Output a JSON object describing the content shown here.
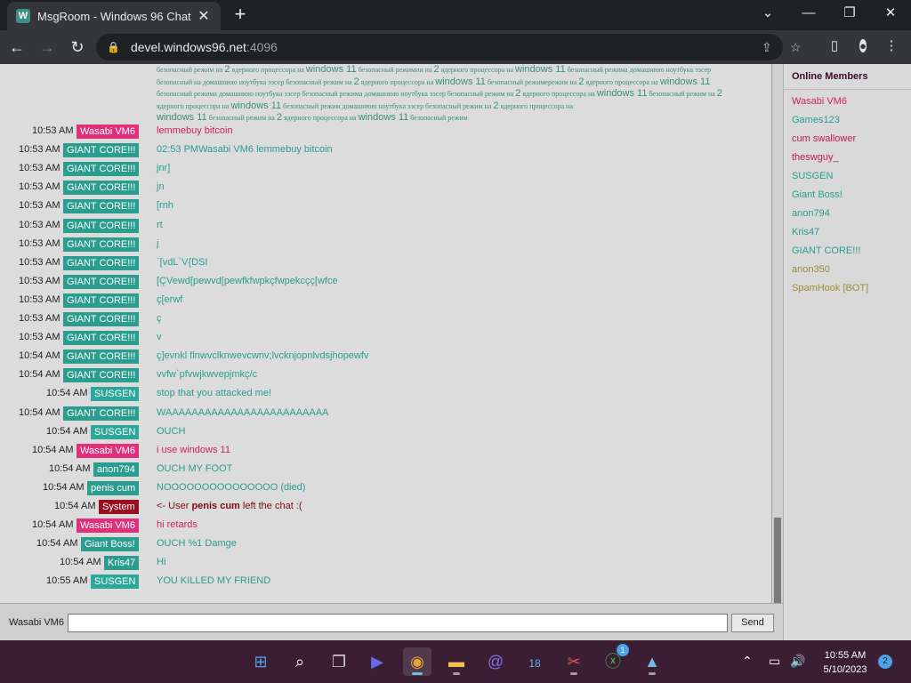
{
  "browser": {
    "tab_title": "MsgRoom - Windows 96 Chat",
    "tab_icon": "W",
    "new_tab": "+",
    "url_host": "devel.windows96.net",
    "url_port": ":4096",
    "window_controls": {
      "chevron": "⌄",
      "minimize": "—",
      "restore": "❐",
      "close": "✕"
    },
    "nav": {
      "back": "←",
      "forward": "→",
      "reload": "↻"
    },
    "lock": "🔒",
    "share": "⇪",
    "star": "☆",
    "sidepanel": "▯",
    "profile": "●",
    "menu": "⋮"
  },
  "chat": {
    "spam_lines": [
      [
        "безопасный режим на ",
        "2",
        " ядерного процессора на ",
        "windows 11",
        " безопасный режимии на ",
        "2",
        " ядерного процессора на ",
        "windows 11",
        " безопасный режима домашнюю ноутбука ээсер"
      ],
      [
        "безопасный на домашнюю ноутбука ээсер безопасный режим на ",
        "2",
        " ядерного процессора на ",
        "windows 11",
        " безопасный режимережим на ",
        "2",
        " ядерного процессора на ",
        "windows 11",
        ""
      ],
      [
        "безопасный режима домашнюю ноутбука ээсер безопасный режима домашнюю ноутбука ээсер безопасный режим на ",
        "2",
        " ядерного процессора на ",
        "windows 11",
        " безопасный режим на ",
        "2",
        ""
      ],
      [
        "ядерного процессора на ",
        "windows 11",
        " безопасный режим домашнюю ноутбука ээсер безопасный режим на ",
        "2",
        " ядерного процессора на ",
        "",
        ""
      ],
      [
        "",
        "windows 11",
        " безопасный режим на ",
        "2",
        " ядерного процессора на ",
        "windows 11",
        " безопасный режим"
      ]
    ],
    "messages": [
      {
        "time": "10:53 AM",
        "user": "Wasabi VM6",
        "color": "#e0307a",
        "text": "lemmebuy bitcoin",
        "text_color": "#d02060"
      },
      {
        "time": "10:53 AM",
        "user": "GIANT CORE!!!",
        "color": "#2a9d8f",
        "text": "02:53 PMWasabi VM6 lemmebuy bitcoin",
        "text_color": "#2a9d8f"
      },
      {
        "time": "10:53 AM",
        "user": "GIANT CORE!!!",
        "color": "#2a9d8f",
        "text": "jnr]",
        "text_color": "#2a9d8f"
      },
      {
        "time": "10:53 AM",
        "user": "GIANT CORE!!!",
        "color": "#2a9d8f",
        "text": "jn",
        "text_color": "#2a9d8f"
      },
      {
        "time": "10:53 AM",
        "user": "GIANT CORE!!!",
        "color": "#2a9d8f",
        "text": "[rnh",
        "text_color": "#2a9d8f"
      },
      {
        "time": "10:53 AM",
        "user": "GIANT CORE!!!",
        "color": "#2a9d8f",
        "text": "rt",
        "text_color": "#2a9d8f"
      },
      {
        "time": "10:53 AM",
        "user": "GIANT CORE!!!",
        "color": "#2a9d8f",
        "text": "j",
        "text_color": "#2a9d8f"
      },
      {
        "time": "10:53 AM",
        "user": "GIANT CORE!!!",
        "color": "#2a9d8f",
        "text": "`[vdL`V{DSI",
        "text_color": "#2a9d8f"
      },
      {
        "time": "10:53 AM",
        "user": "GIANT CORE!!!",
        "color": "#2a9d8f",
        "text": "[ÇVewd[pewvd[pewfkfwpkçfwpekcçç[wfce",
        "text_color": "#2a9d8f"
      },
      {
        "time": "10:53 AM",
        "user": "GIANT CORE!!!",
        "color": "#2a9d8f",
        "text": "ç[erwf",
        "text_color": "#2a9d8f"
      },
      {
        "time": "10:53 AM",
        "user": "GIANT CORE!!!",
        "color": "#2a9d8f",
        "text": "ç",
        "text_color": "#2a9d8f"
      },
      {
        "time": "10:53 AM",
        "user": "GIANT CORE!!!",
        "color": "#2a9d8f",
        "text": "v",
        "text_color": "#2a9d8f"
      },
      {
        "time": "10:54 AM",
        "user": "GIANT CORE!!!",
        "color": "#2a9d8f",
        "text": "ç]evnkl flnwvclknwevcwnv;lvcknjopnlvdsjhopewfv",
        "text_color": "#2a9d8f"
      },
      {
        "time": "10:54 AM",
        "user": "GIANT CORE!!!",
        "color": "#2a9d8f",
        "text": "vvfw`pfvwjkwvepjmkç/c",
        "text_color": "#2a9d8f"
      },
      {
        "time": "10:54 AM",
        "user": "SUSGEN",
        "color": "#2ba89a",
        "text": "stop that you attacked me!",
        "text_color": "#2a9d8f"
      },
      {
        "time": "10:54 AM",
        "user": "GIANT CORE!!!",
        "color": "#2a9d8f",
        "text": "WAAAAAAAAAAAAAAAAAAAAAAAAA",
        "text_color": "#2a9d8f"
      },
      {
        "time": "10:54 AM",
        "user": "SUSGEN",
        "color": "#2ba89a",
        "text": "OUCH",
        "text_color": "#2a9d8f"
      },
      {
        "time": "10:54 AM",
        "user": "Wasabi VM6",
        "color": "#e0307a",
        "text": "i use windows 11",
        "text_color": "#d02060"
      },
      {
        "time": "10:54 AM",
        "user": "anon794",
        "color": "#2a9d8f",
        "text": "OUCH MY FOOT",
        "text_color": "#2a9d8f"
      },
      {
        "time": "10:54 AM",
        "user": "penis cum",
        "color": "#2a9d8f",
        "text": "NOOOOOOOOOOOOOOO (died)",
        "text_color": "#2a9d8f"
      },
      {
        "time": "10:54 AM",
        "user": "System",
        "color": "#9a0d1e",
        "text_prefix": "<- User ",
        "text_bold": "penis cum",
        "text": " left the chat :(",
        "text_color": "#7a0a1a"
      },
      {
        "time": "10:54 AM",
        "user": "Wasabi VM6",
        "color": "#e0307a",
        "text": "hi retards",
        "text_color": "#d02060"
      },
      {
        "time": "10:54 AM",
        "user": "Giant Boss!",
        "color": "#2a9d8f",
        "text": "OUCH %1 Damge",
        "text_color": "#2a9d8f"
      },
      {
        "time": "10:54 AM",
        "user": "Kris47",
        "color": "#2a9d8f",
        "text": "Hi",
        "text_color": "#2a9d8f"
      },
      {
        "time": "10:55 AM",
        "user": "SUSGEN",
        "color": "#2ba89a",
        "text": "YOU KILLED MY FRIEND",
        "text_color": "#2a9d8f"
      }
    ]
  },
  "members": {
    "title": "Online Members",
    "list": [
      {
        "name": "Wasabi VM6",
        "color": "#d02060"
      },
      {
        "name": "Games123",
        "color": "#2a9d8f"
      },
      {
        "name": "cum swallower",
        "color": "#c0185a"
      },
      {
        "name": "theswguy_",
        "color": "#c0185a"
      },
      {
        "name": "SUSGEN",
        "color": "#2a9d8f"
      },
      {
        "name": "Giant Boss!",
        "color": "#2a9d8f"
      },
      {
        "name": "anon794",
        "color": "#2a9d8f"
      },
      {
        "name": "Kris47",
        "color": "#2a9d8f"
      },
      {
        "name": "GIANT CORE!!!",
        "color": "#2a9d8f"
      },
      {
        "name": "anon350",
        "color": "#a08a3a"
      },
      {
        "name": "SpamHook [BOT]",
        "color": "#a08a3a"
      }
    ]
  },
  "input": {
    "username": "Wasabi VM6",
    "value": "",
    "placeholder": "",
    "send_label": "Send"
  },
  "taskbar": {
    "icons": [
      {
        "name": "start-icon",
        "glyph": "⊞",
        "color": "#4aa3e8"
      },
      {
        "name": "search-icon",
        "glyph": "⌕",
        "color": "#ffffff"
      },
      {
        "name": "task-view-icon",
        "glyph": "❐",
        "color": "#d0d0d0"
      },
      {
        "name": "meet-icon",
        "glyph": "▶",
        "color": "#6a6ae8"
      },
      {
        "name": "chrome-icon",
        "glyph": "◉",
        "color": "#e8a33a"
      },
      {
        "name": "file-explorer-icon",
        "glyph": "▬",
        "color": "#f2c14e"
      },
      {
        "name": "mail-icon",
        "glyph": "@",
        "color": "#8a6ee8"
      },
      {
        "name": "calendar-icon",
        "glyph": "18",
        "color": "#6ab0e8"
      },
      {
        "name": "snipping-tool-icon",
        "glyph": "✂",
        "color": "#e05a5a"
      },
      {
        "name": "xbox-icon",
        "glyph": "ⓧ",
        "color": "#3ac040"
      },
      {
        "name": "photos-icon",
        "glyph": "▲",
        "color": "#7ab8e8"
      }
    ],
    "xbox_badge": "1",
    "tray_chevron": "⌃",
    "tray_network": "▭",
    "tray_volume": "🔊",
    "time": "10:55 AM",
    "date": "5/10/2023",
    "notifications": "2"
  }
}
